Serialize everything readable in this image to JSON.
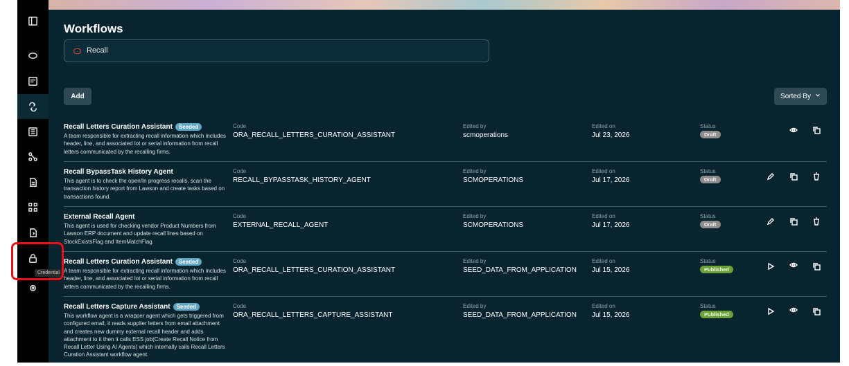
{
  "page": {
    "title": "Workflows"
  },
  "search": {
    "value": "Recall"
  },
  "toolbar": {
    "add_label": "Add",
    "sort_label": "Sorted By"
  },
  "sidebar": {
    "tooltip": "Credential"
  },
  "labels": {
    "code": "Code",
    "edited_by": "Edited by",
    "edited_on": "Edited on",
    "status": "Status"
  },
  "rows": [
    {
      "name": "Recall Letters Curation Assistant",
      "badge": "Seeded",
      "description": "A team responsible for extracting recall information which includes header, line, and associated lot or serial information from recall letters communicated by the recalling firms.",
      "code": "ORA_RECALL_LETTERS_CURATION_ASSISTANT",
      "edited_by": "scmoperations",
      "edited_on": "Jul 23, 2026",
      "status": "Draft"
    },
    {
      "name": "Recall BypassTask History Agent",
      "badge": "",
      "description": "This agent is to check the open/In progress recalls, scan the transaction history report from Lawson and create tasks based on transactions found.",
      "code": "RECALL_BYPASSTASK_HISTORY_AGENT",
      "edited_by": "SCMOPERATIONS",
      "edited_on": "Jul 17, 2026",
      "status": "Draft"
    },
    {
      "name": "External Recall Agent",
      "badge": "",
      "description": "This agent is used for checking vendor Product Numbers from Lawson ERP document and update recall lines based on StockExistsFlag and ItemMatchFlag.",
      "code": "EXTERNAL_RECALL_AGENT",
      "edited_by": "SCMOPERATIONS",
      "edited_on": "Jul 17, 2026",
      "status": "Draft"
    },
    {
      "name": "Recall Letters Curation Assistant",
      "badge": "Seeded",
      "description": "A team responsible for extracting recall information which includes header, line, and associated lot or serial information from recall letters communicated by the recalling firms.",
      "code": "ORA_RECALL_LETTERS_CURATION_ASSISTANT",
      "edited_by": "SEED_DATA_FROM_APPLICATION",
      "edited_on": "Jul 15, 2026",
      "status": "Published"
    },
    {
      "name": "Recall Letters Capture Assistant",
      "badge": "Seeded",
      "description": "This workflow agent is a wrapper agent which gets triggered from configured email, it reads supplier letters from email attachment and creates new dummy external recall header and adds attachment to it then it calls ESS job(Create Recall Notice from Recall Letter Using AI Agents) which internally calls Recall Letters Curation Assistant workflow agent.",
      "code": "ORA_RECALL_LETTERS_CAPTURE_ASSISTANT",
      "edited_by": "SEED_DATA_FROM_APPLICATION",
      "edited_on": "Jul 15, 2026",
      "status": "Published"
    }
  ]
}
